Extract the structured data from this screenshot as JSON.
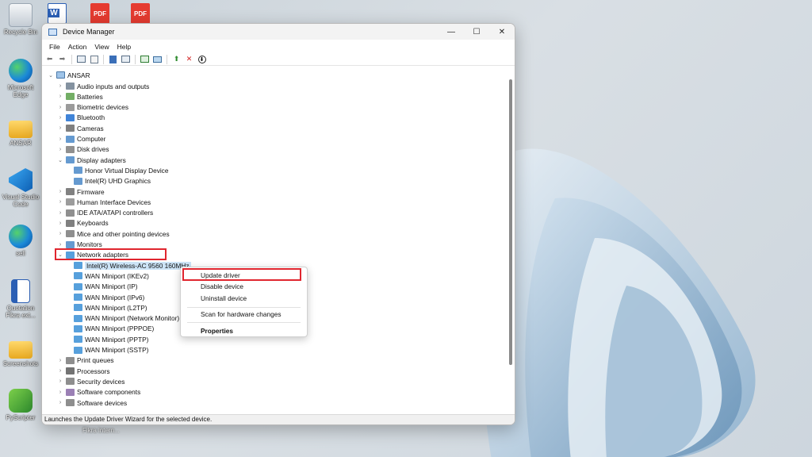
{
  "desktop": {
    "icons": [
      {
        "label": "Recycle Bin"
      },
      {
        "label": "Microsoft Edge"
      },
      {
        "label": "ANSAR"
      },
      {
        "label": "Visual Studio Code"
      },
      {
        "label": "sell"
      },
      {
        "label": "Quotation Fikra ext..."
      },
      {
        "label": "Screenshots"
      },
      {
        "label": "PyScripter"
      }
    ],
    "top_files": [
      {
        "label": "W"
      },
      {
        "label": "PDF"
      },
      {
        "label": "PDF"
      }
    ],
    "background_caption": "Fikra lntern..."
  },
  "window": {
    "title": "Device Manager",
    "controls": {
      "minimize": "—",
      "maximize": "☐",
      "close": "✕"
    },
    "menu": [
      "File",
      "Action",
      "View",
      "Help"
    ],
    "status_text": "Launches the Update Driver Wizard for the selected device."
  },
  "tree": {
    "root": "ANSAR",
    "items": [
      {
        "label": "Audio inputs and outputs",
        "twisty": "›"
      },
      {
        "label": "Batteries",
        "twisty": "›"
      },
      {
        "label": "Biometric devices",
        "twisty": "›"
      },
      {
        "label": "Bluetooth",
        "twisty": "›"
      },
      {
        "label": "Cameras",
        "twisty": "›"
      },
      {
        "label": "Computer",
        "twisty": "›"
      },
      {
        "label": "Disk drives",
        "twisty": "›"
      },
      {
        "label": "Display adapters",
        "twisty": "⌄"
      },
      {
        "label": "Honor Virtual Display Device",
        "twisty": ""
      },
      {
        "label": "Intel(R) UHD Graphics",
        "twisty": ""
      },
      {
        "label": "Firmware",
        "twisty": "›"
      },
      {
        "label": "Human Interface Devices",
        "twisty": "›"
      },
      {
        "label": "IDE ATA/ATAPI controllers",
        "twisty": "›"
      },
      {
        "label": "Keyboards",
        "twisty": "›"
      },
      {
        "label": "Mice and other pointing devices",
        "twisty": "›"
      },
      {
        "label": "Monitors",
        "twisty": "›"
      },
      {
        "label": "Network adapters",
        "twisty": "⌄"
      },
      {
        "label": "Intel(R) Wireless-AC 9560 160MHz",
        "twisty": ""
      },
      {
        "label": "WAN Miniport (IKEv2)",
        "twisty": ""
      },
      {
        "label": "WAN Miniport (IP)",
        "twisty": ""
      },
      {
        "label": "WAN Miniport (IPv6)",
        "twisty": ""
      },
      {
        "label": "WAN Miniport (L2TP)",
        "twisty": ""
      },
      {
        "label": "WAN Miniport (Network Monitor)",
        "twisty": ""
      },
      {
        "label": "WAN Miniport (PPPOE)",
        "twisty": ""
      },
      {
        "label": "WAN Miniport (PPTP)",
        "twisty": ""
      },
      {
        "label": "WAN Miniport (SSTP)",
        "twisty": ""
      },
      {
        "label": "Print queues",
        "twisty": "›"
      },
      {
        "label": "Processors",
        "twisty": "›"
      },
      {
        "label": "Security devices",
        "twisty": "›"
      },
      {
        "label": "Software components",
        "twisty": "›"
      },
      {
        "label": "Software devices",
        "twisty": "›"
      }
    ]
  },
  "context_menu": {
    "items": [
      "Update driver",
      "Disable device",
      "Uninstall device",
      "Scan for hardware changes",
      "Properties"
    ]
  },
  "colors": {
    "highlight_red": "#e0262f",
    "selection": "#cce4f7",
    "accent_blue": "#1f6fd1"
  }
}
